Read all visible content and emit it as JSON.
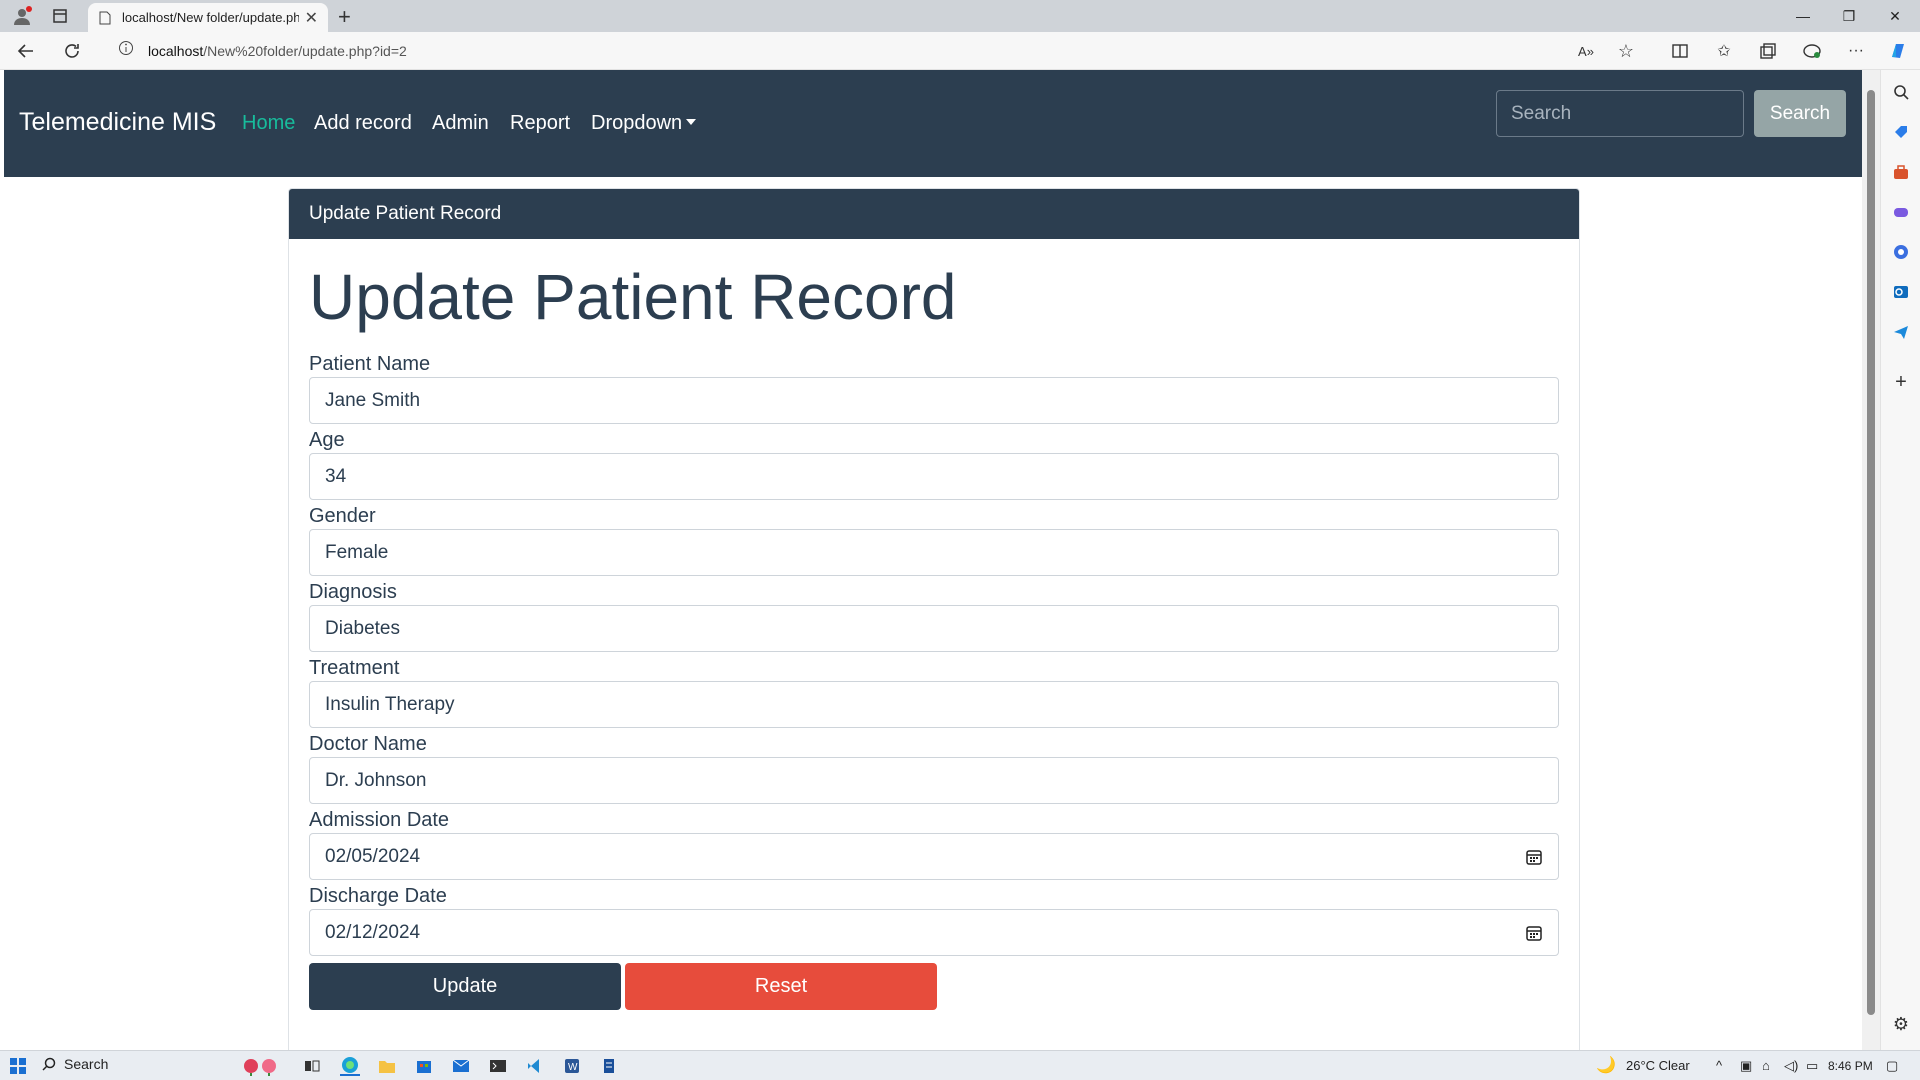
{
  "browser": {
    "tab_title": "localhost/New folder/update.php",
    "url_host": "localhost",
    "url_path": "/New%20folder/update.php?id=2"
  },
  "nav": {
    "brand": "Telemedicine MIS",
    "links": [
      "Home",
      "Add record",
      "Admin",
      "Report",
      "Dropdown"
    ],
    "search_placeholder": "Search",
    "search_button": "Search"
  },
  "card": {
    "header": "Update Patient Record",
    "title": "Update Patient Record",
    "fields": [
      {
        "label": "Patient Name",
        "value": "Jane Smith"
      },
      {
        "label": "Age",
        "value": "34"
      },
      {
        "label": "Gender",
        "value": "Female"
      },
      {
        "label": "Diagnosis",
        "value": "Diabetes"
      },
      {
        "label": "Treatment",
        "value": "Insulin Therapy"
      },
      {
        "label": "Doctor Name",
        "value": "Dr. Johnson"
      },
      {
        "label": "Admission Date",
        "value": "02/05/2024"
      },
      {
        "label": "Discharge Date",
        "value": "02/12/2024"
      }
    ],
    "update_button": "Update",
    "reset_button": "Reset"
  },
  "taskbar": {
    "search": "Search",
    "weather": "26°C  Clear",
    "time": "8:46 PM"
  },
  "colors": {
    "primary": "#2c3e50",
    "success": "#18bc9c",
    "danger": "#e74c3c",
    "secondary": "#95a5a6"
  }
}
